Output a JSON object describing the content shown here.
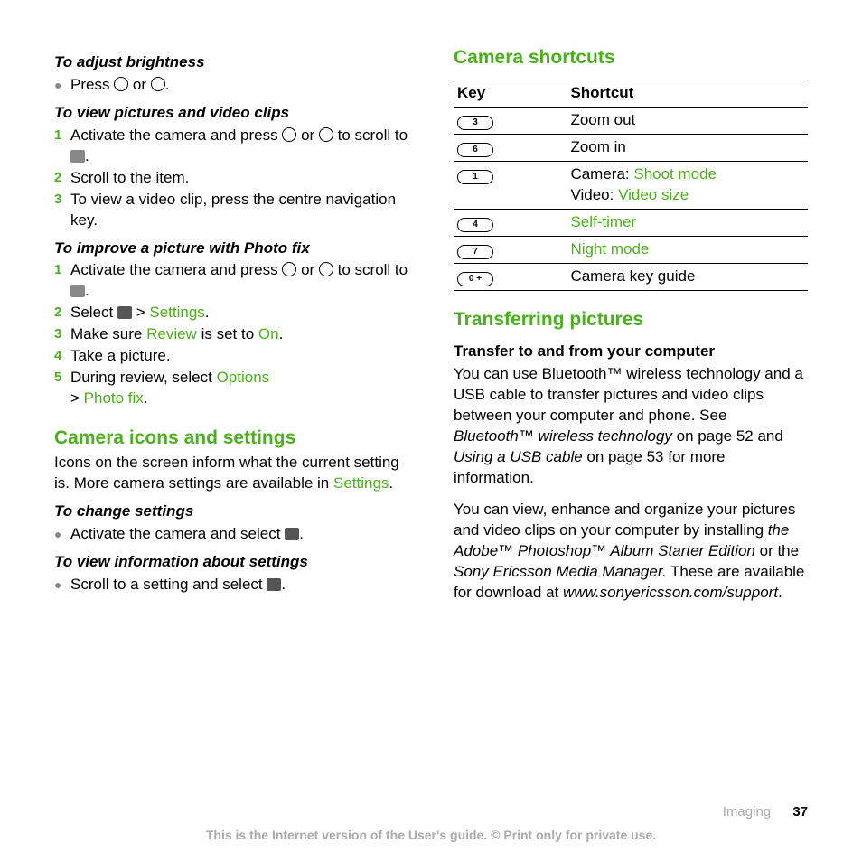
{
  "left": {
    "h_brightness": "To adjust brightness",
    "brightness_step": "Press ○ or ○.",
    "h_view": "To view pictures and video clips",
    "view_steps": [
      "Activate the camera and press ○ or ○ to scroll to ▢.",
      "Scroll to the item.",
      "To view a video clip, press the centre navigation key."
    ],
    "h_photofix": "To improve a picture with Photo fix",
    "pf1": "Activate the camera and press ○ or ○ to scroll to ▢.",
    "pf2_a": "Select ▢ > ",
    "pf2_b": "Settings",
    "pf2_c": ".",
    "pf3_a": "Make sure ",
    "pf3_b": "Review",
    "pf3_c": " is set to ",
    "pf3_d": "On",
    "pf3_e": ".",
    "pf4": "Take a picture.",
    "pf5_a": "During review, select ",
    "pf5_b": "Options",
    "pf5_c": " > ",
    "pf5_d": "Photo fix",
    "pf5_e": ".",
    "sect_icons": "Camera icons and settings",
    "icons_intro_a": "Icons on the screen inform what the current setting is. More camera settings are available in ",
    "icons_intro_b": "Settings",
    "icons_intro_c": ".",
    "h_change": "To change settings",
    "change_step": "Activate the camera and select ▢.",
    "h_info": "To view information about settings",
    "info_step": "Scroll to a setting and select ▢."
  },
  "right": {
    "sect_shortcuts": "Camera shortcuts",
    "th_key": "Key",
    "th_shortcut": "Shortcut",
    "rows": [
      {
        "key": "3",
        "plain": "Zoom out"
      },
      {
        "key": "6",
        "plain": "Zoom in"
      },
      {
        "key": "1",
        "camera_label": "Camera: ",
        "camera_link": "Shoot mode",
        "video_label": "Video: ",
        "video_link": "Video size"
      },
      {
        "key": "4",
        "link": "Self-timer"
      },
      {
        "key": "7",
        "link": "Night mode"
      },
      {
        "key": "0 +",
        "plain": "Camera key guide"
      }
    ],
    "sect_transfer": "Transferring pictures",
    "transfer_sub": "Transfer to and from your computer",
    "p1_a": "You can use Bluetooth™ wireless technology and a USB cable to transfer pictures and video clips between your computer and phone. See ",
    "p1_b": "Bluetooth™ wireless technology",
    "p1_c": " on page 52 and ",
    "p1_d": "Using a USB cable",
    "p1_e": " on page 53 for more information.",
    "p2_a": "You can view, enhance and organize your pictures and video clips on your computer by installing ",
    "p2_b": "the Adobe™ Photoshop™ Album Starter Edition",
    "p2_c": " or the ",
    "p2_d": "Sony Ericsson Media Manager.",
    "p2_e": " These are available for download at ",
    "p2_f": "www.sonyericsson.com/support",
    "p2_g": "."
  },
  "footer": {
    "section": "Imaging",
    "page": "37",
    "notice": "This is the Internet version of the User's guide. © Print only for private use."
  }
}
